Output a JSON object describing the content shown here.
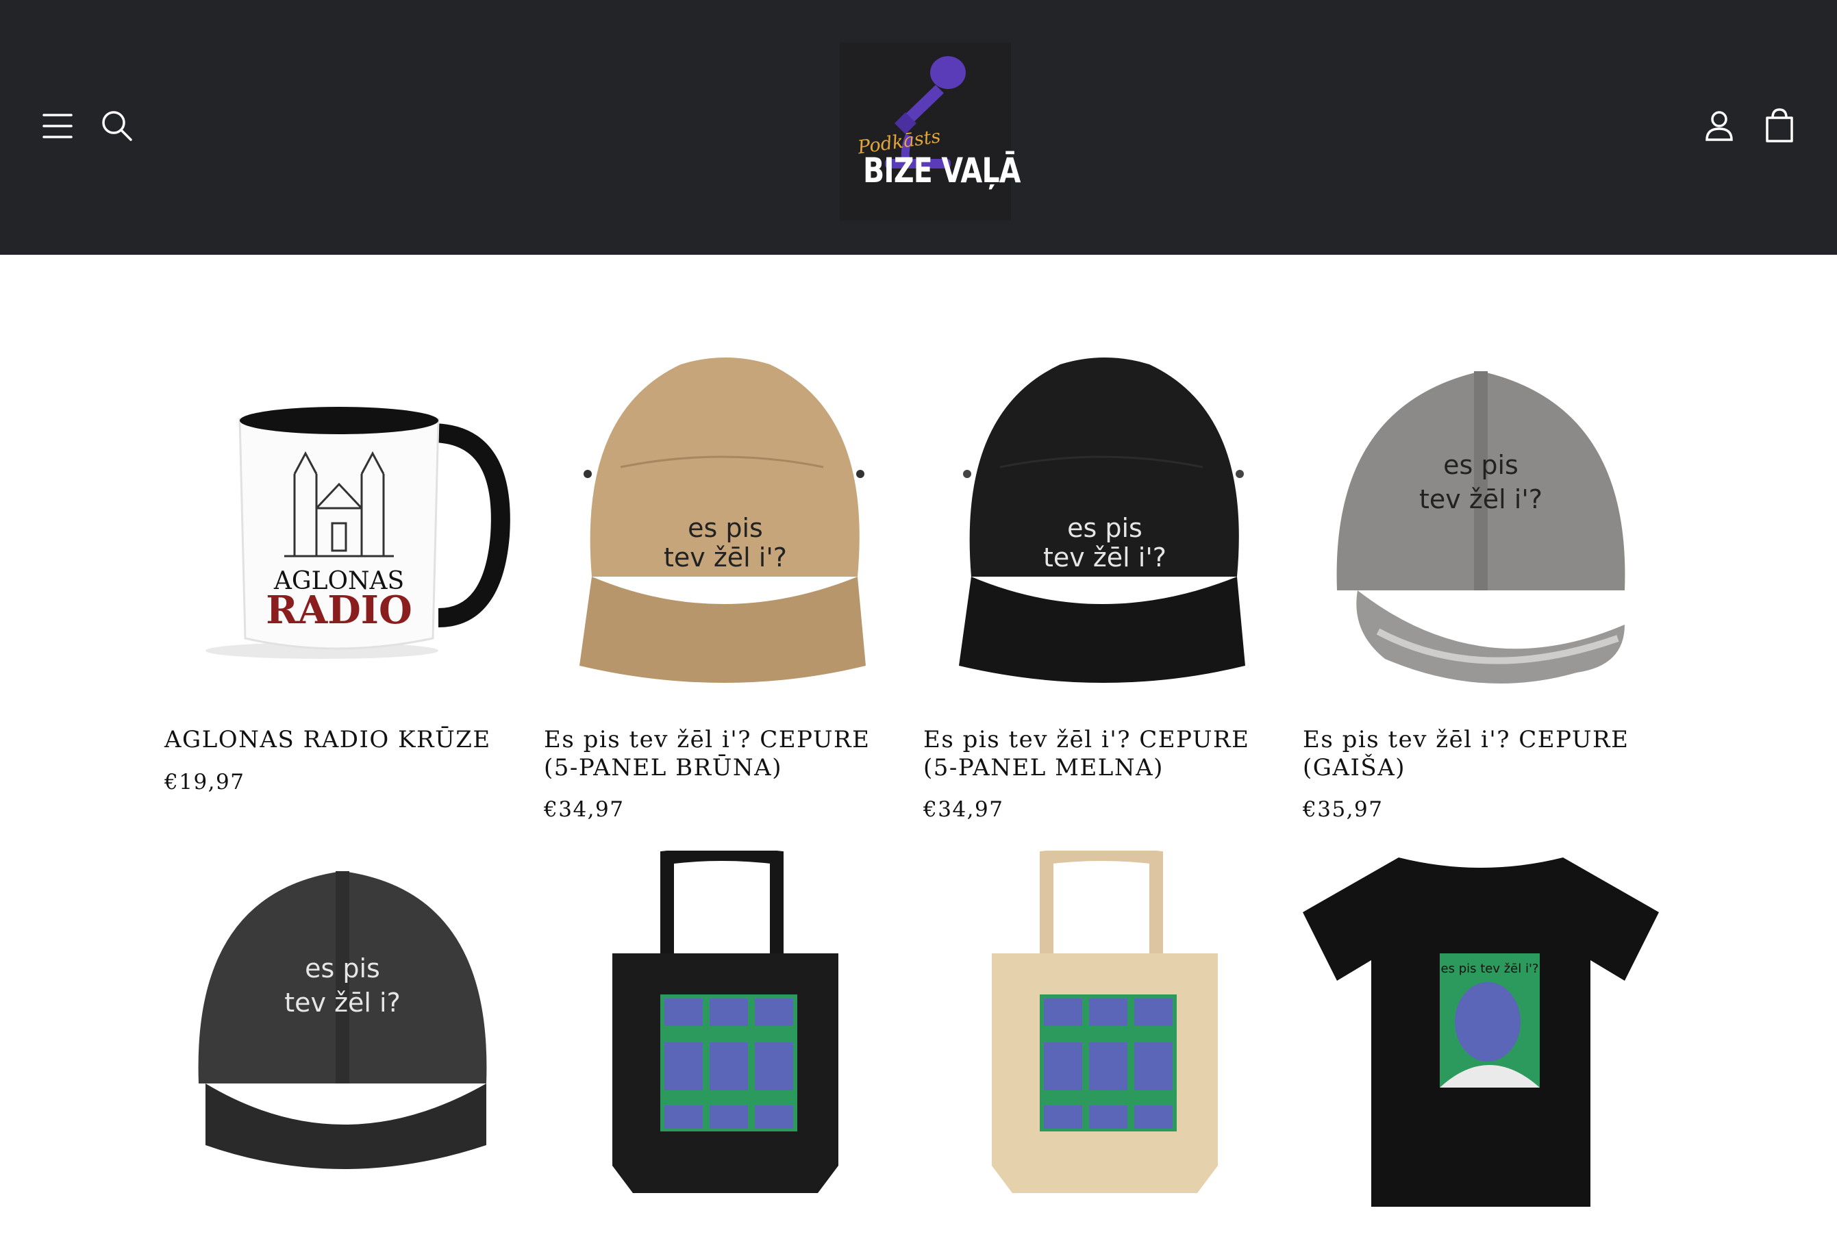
{
  "header": {
    "logo_small": "Podkāsts",
    "logo_main": "BIZE VAĻĀ",
    "colors": {
      "background": "#232427",
      "logo_purple": "#5a3bb8",
      "logo_gold": "#e2a63a"
    }
  },
  "products": [
    {
      "title": "AGLONAS RADIO KRŪZE",
      "price": "€19,97"
    },
    {
      "title": "Es pis tev žēl i'? CEPURE (5-PANEL BRŪNA)",
      "price": "€34,97"
    },
    {
      "title": "Es pis tev žēl i'? CEPURE (5-PANEL MELNA)",
      "price": "€34,97"
    },
    {
      "title": "Es pis tev žēl i'? CEPURE (GAIŠA)",
      "price": "€35,97"
    }
  ],
  "product_art": {
    "mug_line1": "AGLONAS",
    "mug_line2": "RADIO",
    "hat_line1": "es pis",
    "hat_line2": "tev žēl i'?",
    "hat_line2_b": "tev žēl i?",
    "tee_caption": "es pis tev žēl i'?"
  }
}
